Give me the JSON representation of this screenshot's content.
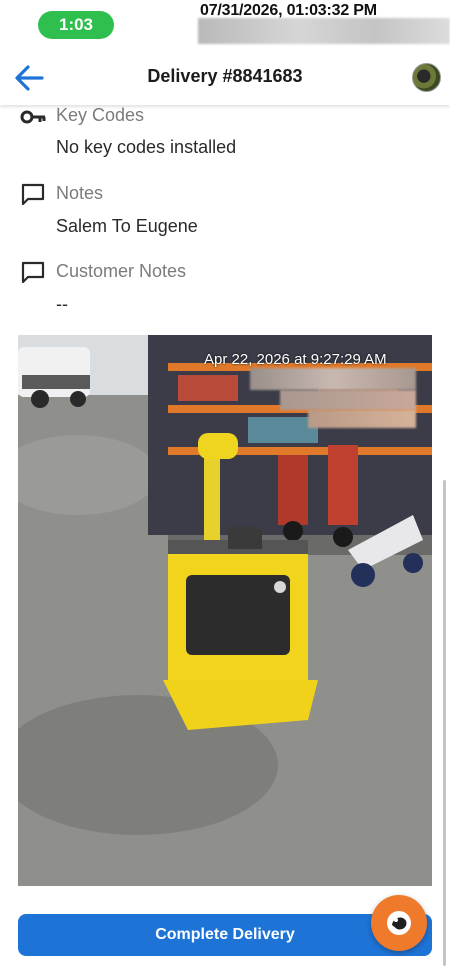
{
  "status_bar": {
    "time": "1:03",
    "timestamp": "07/31/2026, 01:03:32 PM"
  },
  "header": {
    "title": "Delivery #8841683",
    "back_icon": "arrow-left-icon",
    "avatar_icon": "user-avatar-icon"
  },
  "sections": {
    "key_codes": {
      "label": "Key Codes",
      "value": "No key codes installed",
      "icon": "key-icon"
    },
    "notes": {
      "label": "Notes",
      "value": "Salem To Eugene",
      "icon": "comment-icon"
    },
    "customer_notes": {
      "label": "Customer Notes",
      "value": "--",
      "icon": "comment-icon"
    }
  },
  "photo": {
    "stamp": "Apr 22, 2026 at 9:27:29 AM"
  },
  "actions": {
    "complete_label": "Complete Delivery",
    "fab_icon": "chat-support-icon"
  },
  "colors": {
    "accent": "#1e74d6",
    "status_green": "#2fbf4f",
    "fab_orange": "#f07a2c"
  }
}
